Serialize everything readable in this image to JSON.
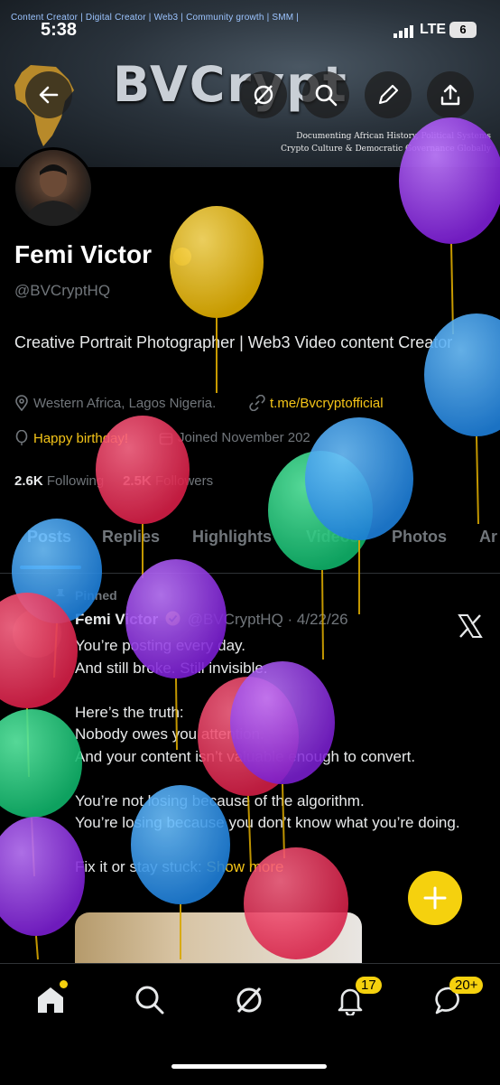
{
  "status_bar": {
    "time": "5:38",
    "network": "LTE",
    "battery": "6"
  },
  "banner": {
    "tagline": "Content Creator | Digital Creator | Web3 | Community growth | SMM |",
    "brand": "BVCrypt",
    "subtitle_line1": "Documenting African History, Political Systems",
    "subtitle_line2": "Crypto Culture & Democratic Governance Globally"
  },
  "profile": {
    "name": "Femi Victor",
    "handle": "@BVCryptHQ",
    "bio": "Creative Portrait Photographer | Web3 Video content Creator",
    "location": "Western Africa, Lagos Nigeria.",
    "link": "t.me/Bvcryptofficial",
    "birthday": "Happy birthday!",
    "joined": "Joined November 202",
    "following_count": "2.6K",
    "following_label": "Following",
    "followers_count": "2.5K",
    "followers_label": "Followers"
  },
  "tabs": [
    "Posts",
    "Replies",
    "Highlights",
    "Videos",
    "Photos",
    "Ar"
  ],
  "post": {
    "pinned_label": "Pinned",
    "author": "Femi Victor",
    "handle_date": "@BVCryptHQ · 4/22/26",
    "text": "You’re posting every day.\nAnd still broke. Still invisible.\n\nHere’s the truth:\nNobody owes you attention.\nAnd your content isn’t valuable enough to convert.\n\nYou’re not losing because of the algorithm.\nYou’re losing because you don’t know what you’re doing.\n\nFix it or stay stuck:",
    "show_more": "Show more"
  },
  "nav": {
    "notifications_badge": "17",
    "messages_badge": "20+"
  },
  "colors": {
    "accent": "#f5d10e",
    "link": "#f5c518",
    "tab_underline": "#1d9bf0",
    "background": "#000000"
  },
  "icons": [
    "back-icon",
    "grok-icon",
    "search-icon",
    "edit-icon",
    "share-icon",
    "location-icon",
    "link-icon",
    "balloon-icon",
    "calendar-icon",
    "pin-icon",
    "x-logo-icon",
    "plus-icon",
    "home-icon",
    "explore-icon",
    "bell-icon",
    "messages-icon"
  ]
}
